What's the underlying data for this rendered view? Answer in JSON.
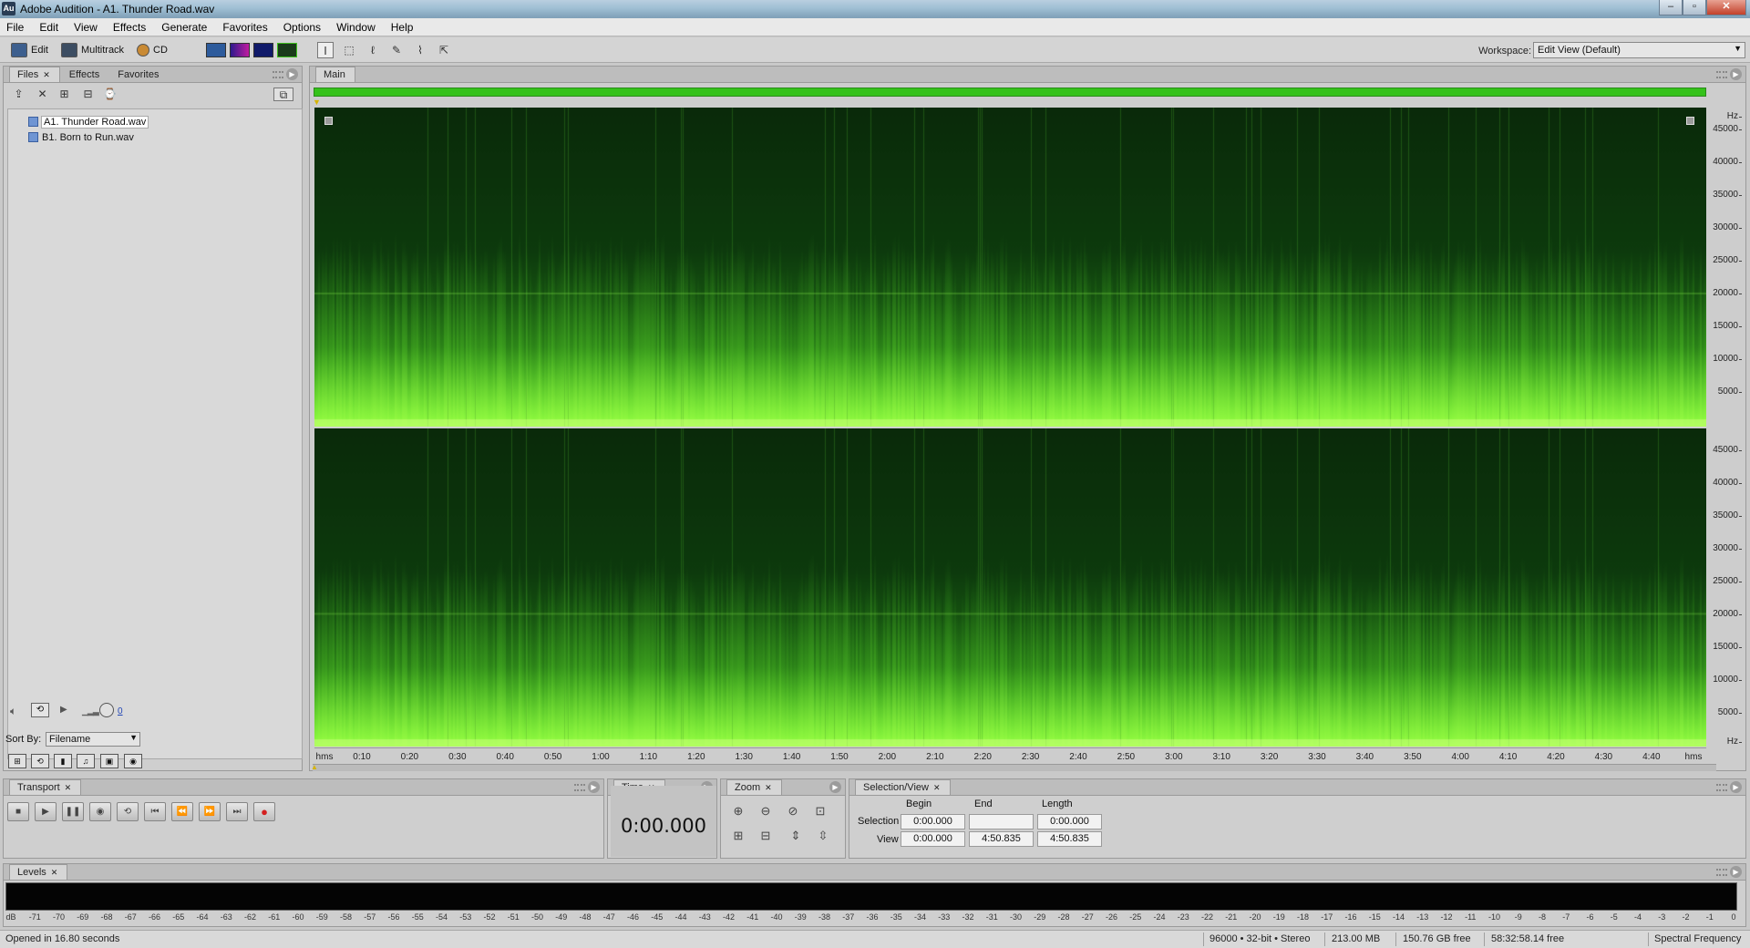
{
  "window": {
    "title": "Adobe Audition - A1. Thunder Road.wav",
    "app_icon": "Au"
  },
  "menu": [
    "File",
    "Edit",
    "View",
    "Effects",
    "Generate",
    "Favorites",
    "Options",
    "Window",
    "Help"
  ],
  "toolbar": {
    "edit": "Edit",
    "multitrack": "Multitrack",
    "cd": "CD",
    "workspace_label": "Workspace:",
    "workspace_value": "Edit View (Default)"
  },
  "files_panel": {
    "tabs": [
      "Files",
      "Effects",
      "Favorites"
    ],
    "files": [
      "A1. Thunder Road.wav",
      "B1. Born to Run.wav"
    ],
    "volume_value": "0",
    "sort_label": "Sort By:",
    "sort_value": "Filename"
  },
  "main_panel": {
    "tab": "Main",
    "hz_unit": "Hz",
    "hz_ticks": [
      "45000",
      "40000",
      "35000",
      "30000",
      "25000",
      "20000",
      "15000",
      "10000",
      "5000"
    ],
    "time_unit": "hms",
    "time_ticks": [
      "0:10",
      "0:20",
      "0:30",
      "0:40",
      "0:50",
      "1:00",
      "1:10",
      "1:20",
      "1:30",
      "1:40",
      "1:50",
      "2:00",
      "2:10",
      "2:20",
      "2:30",
      "2:40",
      "2:50",
      "3:00",
      "3:10",
      "3:20",
      "3:30",
      "3:40",
      "3:50",
      "4:00",
      "4:10",
      "4:20",
      "4:30",
      "4:40"
    ]
  },
  "transport": {
    "tab": "Transport"
  },
  "time": {
    "tab": "Time",
    "value": "0:00.000"
  },
  "zoom": {
    "tab": "Zoom"
  },
  "selection_view": {
    "tab": "Selection/View",
    "headers": [
      "Begin",
      "End",
      "Length"
    ],
    "selection_label": "Selection",
    "view_label": "View",
    "selection": {
      "begin": "0:00.000",
      "end": "",
      "length": "0:00.000"
    },
    "view": {
      "begin": "0:00.000",
      "end": "4:50.835",
      "length": "4:50.835"
    }
  },
  "levels": {
    "tab": "Levels",
    "db_ticks": [
      "dB",
      "-71",
      "-70",
      "-69",
      "-68",
      "-67",
      "-66",
      "-65",
      "-64",
      "-63",
      "-62",
      "-61",
      "-60",
      "-59",
      "-58",
      "-57",
      "-56",
      "-55",
      "-54",
      "-53",
      "-52",
      "-51",
      "-50",
      "-49",
      "-48",
      "-47",
      "-46",
      "-45",
      "-44",
      "-43",
      "-42",
      "-41",
      "-40",
      "-39",
      "-38",
      "-37",
      "-36",
      "-35",
      "-34",
      "-33",
      "-32",
      "-31",
      "-30",
      "-29",
      "-28",
      "-27",
      "-26",
      "-25",
      "-24",
      "-23",
      "-22",
      "-21",
      "-20",
      "-19",
      "-18",
      "-17",
      "-16",
      "-15",
      "-14",
      "-13",
      "-12",
      "-11",
      "-10",
      "-9",
      "-8",
      "-7",
      "-6",
      "-5",
      "-4",
      "-3",
      "-2",
      "-1",
      "0"
    ]
  },
  "status": {
    "message": "Opened in 16.80 seconds",
    "format": "96000 • 32-bit • Stereo",
    "size": "213.00 MB",
    "disk_free": "150.76 GB free",
    "time_free": "58:32:58.14 free",
    "view_mode": "Spectral Frequency"
  },
  "colors": {
    "spectral_green": "#7dff3a",
    "overview_bar": "#35c21a",
    "record_red": "#d42020"
  }
}
